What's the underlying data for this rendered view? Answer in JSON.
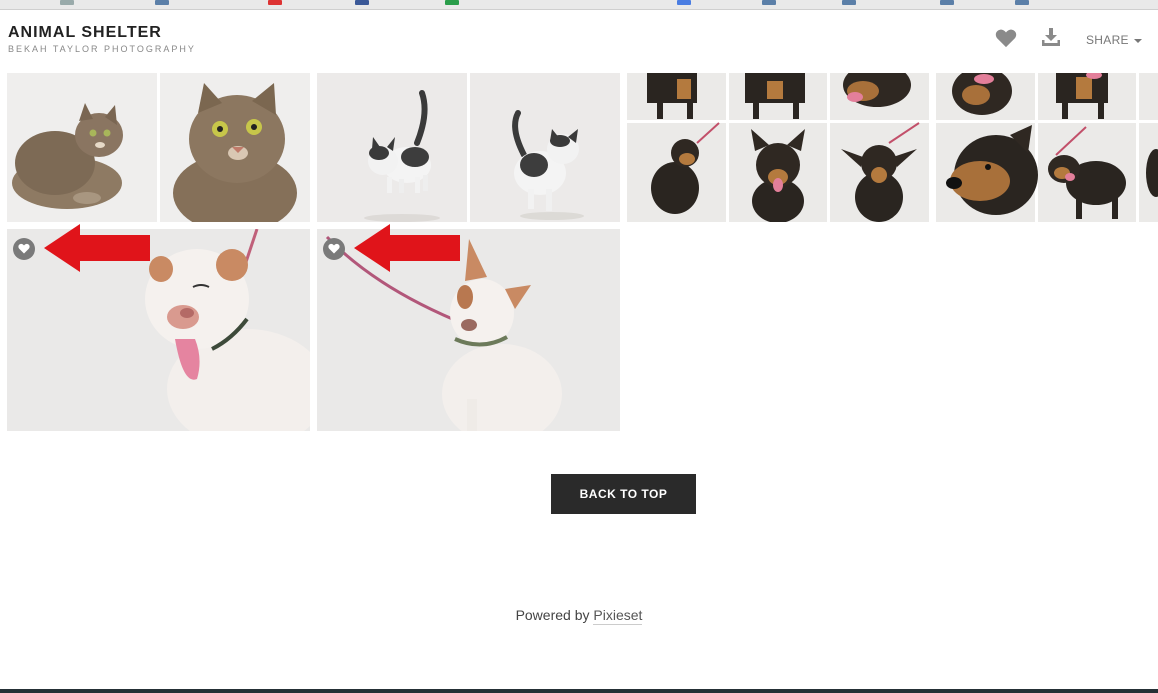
{
  "header": {
    "title": "ANIMAL SHELTER",
    "subtitle": "BEKAH TAYLOR PHOTOGRAPHY",
    "share_label": "SHARE",
    "icons": [
      "heart-icon",
      "download-icon",
      "chevron-down-icon"
    ]
  },
  "gallery": {
    "rows": [
      {
        "photos": [
          "tabby cat lying",
          "tabby cat close-up",
          "kitten standing",
          "kitten looking up",
          "dog collage 1",
          "dog collage 2"
        ]
      },
      {
        "photos": [
          "smiling pit bull",
          "pit bull with leash"
        ]
      }
    ],
    "favorite_icon": "heart-icon",
    "annotation_color": "#e0141a"
  },
  "footer": {
    "back_to_top": "BACK TO TOP",
    "powered_prefix": "Powered by",
    "powered_link": "Pixieset"
  },
  "colors": {
    "button_bg": "#2a2a2a",
    "bottom_bar": "#253036"
  }
}
